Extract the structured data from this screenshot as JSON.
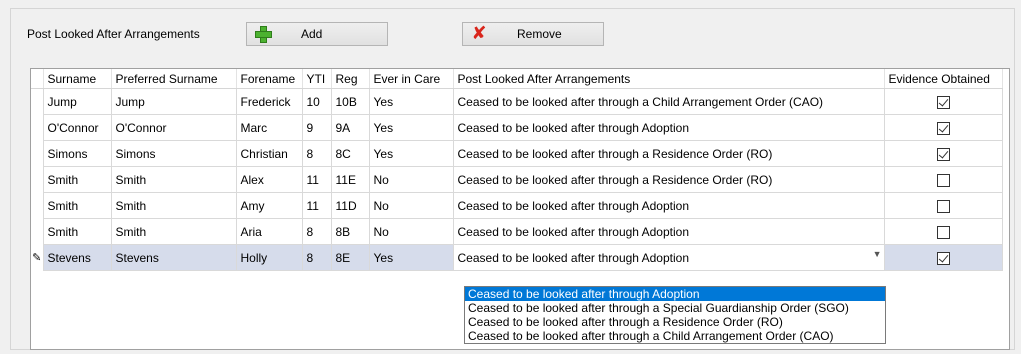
{
  "group_label": "Post Looked After Arrangements",
  "buttons": {
    "add": "Add",
    "remove": "Remove"
  },
  "columns": [
    "Surname",
    "Preferred Surname",
    "Forename",
    "YTI",
    "Reg",
    "Ever in Care",
    "Post Looked After Arrangements",
    "Evidence Obtained"
  ],
  "rows": [
    {
      "surname": "Jump",
      "preferred": "Jump",
      "forename": "Frederick",
      "yti": "10",
      "reg": "10B",
      "care": "Yes",
      "arrangement": "Ceased to be looked after through a Child Arrangement Order (CAO)",
      "evidence": true
    },
    {
      "surname": "O'Connor",
      "preferred": "O'Connor",
      "forename": "Marc",
      "yti": "9",
      "reg": "9A",
      "care": "Yes",
      "arrangement": "Ceased to be looked after through Adoption",
      "evidence": true
    },
    {
      "surname": "Simons",
      "preferred": "Simons",
      "forename": "Christian",
      "yti": "8",
      "reg": "8C",
      "care": "Yes",
      "arrangement": "Ceased to be looked after through a Residence Order (RO)",
      "evidence": true
    },
    {
      "surname": "Smith",
      "preferred": "Smith",
      "forename": "Alex",
      "yti": "11",
      "reg": "11E",
      "care": "No",
      "arrangement": "Ceased to be looked after through a Residence Order (RO)",
      "evidence": false
    },
    {
      "surname": "Smith",
      "preferred": "Smith",
      "forename": "Amy",
      "yti": "11",
      "reg": "11D",
      "care": "No",
      "arrangement": "Ceased to be looked after through Adoption",
      "evidence": false
    },
    {
      "surname": "Smith",
      "preferred": "Smith",
      "forename": "Aria",
      "yti": "8",
      "reg": "8B",
      "care": "No",
      "arrangement": "Ceased to be looked after through Adoption",
      "evidence": false
    },
    {
      "surname": "Stevens",
      "preferred": "Stevens",
      "forename": "Holly",
      "yti": "8",
      "reg": "8E",
      "care": "Yes",
      "arrangement": "Ceased to be looked after through Adoption",
      "evidence": true,
      "editing": true
    }
  ],
  "dropdown_options": [
    "Ceased to be looked after through Adoption",
    "Ceased to be looked after through a Special Guardianship Order (SGO)",
    "Ceased to be looked after through a Residence Order (RO)",
    "Ceased to be looked after through a Child Arrangement Order (CAO)"
  ],
  "dropdown_highlighted": 0,
  "edit_row_marker": "✎",
  "icons": {
    "add": "plus-icon",
    "remove": "x-icon",
    "combo": "chevron-down-icon"
  }
}
